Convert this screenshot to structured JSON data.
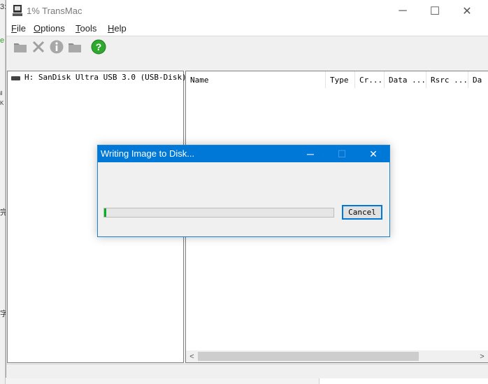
{
  "background": {
    "fragments": [
      "3:",
      "e",
      "il",
      "K",
      "完",
      "字"
    ]
  },
  "window": {
    "title": "1% TransMac",
    "minimize_glyph": "─",
    "maximize_glyph": "☐",
    "close_glyph": "✕"
  },
  "menu": {
    "items": [
      {
        "accel": "F",
        "rest": "ile"
      },
      {
        "accel": "O",
        "rest": "ptions"
      },
      {
        "accel": "T",
        "rest": "ools"
      },
      {
        "accel": "H",
        "rest": "elp"
      }
    ]
  },
  "toolbar": {
    "icons": [
      "folder-icon",
      "delete-icon",
      "info-icon",
      "folder-icon",
      "help-icon"
    ],
    "help_glyph": "?",
    "info_glyph": "i"
  },
  "tree": {
    "items": [
      {
        "label": "H: SanDisk Ultra USB 3.0 (USB-Disk)"
      }
    ]
  },
  "file_list": {
    "columns": [
      "Name",
      "Type",
      "Cr...",
      "Data ...",
      "Rsrc ...",
      "Da"
    ]
  },
  "scrollbar": {
    "left_arrow": "<",
    "right_arrow": ">"
  },
  "dialog": {
    "title": "Writing Image to Disk...",
    "minimize_glyph": "─",
    "maximize_glyph": "☐",
    "close_glyph": "✕",
    "progress_percent": 1,
    "cancel_label": "Cancel"
  },
  "colors": {
    "accent": "#0078d7",
    "progress": "#06b025",
    "help_icon": "#2ea82e"
  }
}
